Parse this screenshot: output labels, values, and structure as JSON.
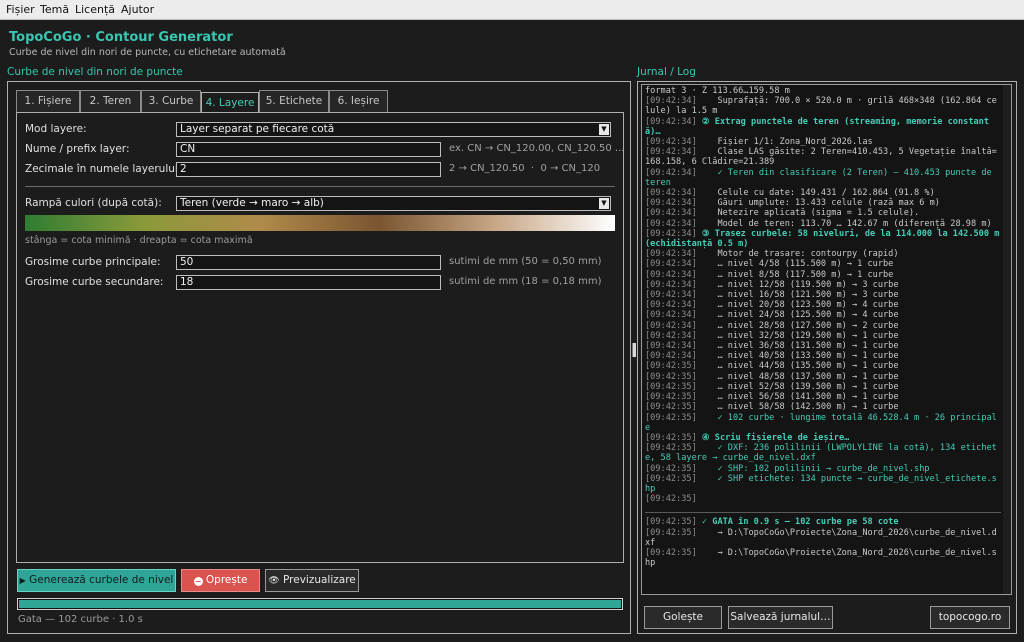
{
  "menu": {
    "items": [
      "Fișier",
      "Temă",
      "Licență",
      "Ajutor"
    ]
  },
  "header": {
    "title": "TopoCoGo · Contour Generator",
    "subtitle": "Curbe de nivel din nori de puncte, cu etichetare automată"
  },
  "left_panel": {
    "title": "Curbe de nivel din nori de puncte"
  },
  "tabs": [
    {
      "label": "1. Fișiere"
    },
    {
      "label": "2. Teren"
    },
    {
      "label": "3. Curbe"
    },
    {
      "label": "4. Layere"
    },
    {
      "label": "5. Etichete"
    },
    {
      "label": "6. Ieșire"
    }
  ],
  "active_tab": "4. Layere",
  "form": {
    "layer_mode": {
      "label": "Mod layere:",
      "value": "Layer separat pe fiecare cotă"
    },
    "layer_prefix": {
      "label": "Nume / prefix layer:",
      "value": "CN",
      "hint": "ex. CN → CN_120.00, CN_120.50 ..."
    },
    "layer_decimals": {
      "label": "Zecimale în numele layerului:",
      "value": "2",
      "hint": "2 → CN_120.50  ·  0 → CN_120"
    },
    "color_ramp": {
      "label": "Rampă culori (după cotă):",
      "value": "Teren (verde → maro → alb)",
      "caption": "stânga = cota minimă · dreapta = cota maximă",
      "colors": [
        "#2f7d32",
        "#8a9a3a",
        "#b08a4a",
        "#7a5530",
        "#c8a888",
        "#ffffff"
      ]
    },
    "major_thickness": {
      "label": "Grosime curbe principale:",
      "value": "50",
      "hint": "sutimi de mm (50 = 0,50 mm)"
    },
    "minor_thickness": {
      "label": "Grosime curbe secundare:",
      "value": "18",
      "hint": "sutimi de mm (18 = 0,18 mm)"
    }
  },
  "actions": {
    "generate": "Generează curbele de nivel",
    "stop": "Oprește",
    "preview": "Previzualizare"
  },
  "progress": {
    "value": 1.0
  },
  "status": "Gata — 102 curbe · 1.0 s",
  "log_panel": {
    "title": "Jurnal / Log"
  },
  "log": [
    {
      "ts": "",
      "text": "format 3 · Z 113.66…159.58 m",
      "style": ""
    },
    {
      "ts": "[09:42:34]",
      "text": "    Suprafață: 700.0 × 520.0 m · grilă 468×348 (162.864 celule) la 1.5 m",
      "style": ""
    },
    {
      "ts": "[09:42:34]",
      "text": " ② Extrag punctele de teren (streaming, memorie constantă)…",
      "style": "hl"
    },
    {
      "ts": "[09:42:34]",
      "text": "    Fișier 1/1: Zona_Nord_2026.las",
      "style": ""
    },
    {
      "ts": "[09:42:34]",
      "text": "    Clase LAS găsite: 2 Teren=410.453, 5 Vegetație înaltă=168.158, 6 Clădire=21.389",
      "style": ""
    },
    {
      "ts": "[09:42:34]",
      "text": "    ✓ Teren din clasificare (2 Teren) — 410.453 puncte de teren",
      "style": "ok"
    },
    {
      "ts": "[09:42:34]",
      "text": "    Celule cu date: 149.431 / 162.864 (91.8 %)",
      "style": ""
    },
    {
      "ts": "[09:42:34]",
      "text": "    Găuri umplute: 13.433 celule (rază max 6 m)",
      "style": ""
    },
    {
      "ts": "[09:42:34]",
      "text": "    Netezire aplicată (sigma = 1.5 celule).",
      "style": ""
    },
    {
      "ts": "[09:42:34]",
      "text": "    Model de teren: 113.70 … 142.67 m (diferență 28.98 m)",
      "style": ""
    },
    {
      "ts": "[09:42:34]",
      "text": " ③ Trasez curbele: 58 niveluri, de la 114.000 la 142.500 m (echidistanță 0.5 m)",
      "style": "hl"
    },
    {
      "ts": "[09:42:34]",
      "text": "    Motor de trasare: contourpy (rapid)",
      "style": ""
    },
    {
      "ts": "[09:42:34]",
      "text": "    … nivel 4/58 (115.500 m) → 1 curbe",
      "style": ""
    },
    {
      "ts": "[09:42:34]",
      "text": "    … nivel 8/58 (117.500 m) → 1 curbe",
      "style": ""
    },
    {
      "ts": "[09:42:34]",
      "text": "    … nivel 12/58 (119.500 m) → 3 curbe",
      "style": ""
    },
    {
      "ts": "[09:42:34]",
      "text": "    … nivel 16/58 (121.500 m) → 3 curbe",
      "style": ""
    },
    {
      "ts": "[09:42:34]",
      "text": "    … nivel 20/58 (123.500 m) → 4 curbe",
      "style": ""
    },
    {
      "ts": "[09:42:34]",
      "text": "    … nivel 24/58 (125.500 m) → 4 curbe",
      "style": ""
    },
    {
      "ts": "[09:42:34]",
      "text": "    … nivel 28/58 (127.500 m) → 2 curbe",
      "style": ""
    },
    {
      "ts": "[09:42:34]",
      "text": "    … nivel 32/58 (129.500 m) → 1 curbe",
      "style": ""
    },
    {
      "ts": "[09:42:34]",
      "text": "    … nivel 36/58 (131.500 m) → 1 curbe",
      "style": ""
    },
    {
      "ts": "[09:42:34]",
      "text": "    … nivel 40/58 (133.500 m) → 1 curbe",
      "style": ""
    },
    {
      "ts": "[09:42:35]",
      "text": "    … nivel 44/58 (135.500 m) → 1 curbe",
      "style": ""
    },
    {
      "ts": "[09:42:35]",
      "text": "    … nivel 48/58 (137.500 m) → 1 curbe",
      "style": ""
    },
    {
      "ts": "[09:42:35]",
      "text": "    … nivel 52/58 (139.500 m) → 1 curbe",
      "style": ""
    },
    {
      "ts": "[09:42:35]",
      "text": "    … nivel 56/58 (141.500 m) → 1 curbe",
      "style": ""
    },
    {
      "ts": "[09:42:35]",
      "text": "    … nivel 58/58 (142.500 m) → 1 curbe",
      "style": ""
    },
    {
      "ts": "[09:42:35]",
      "text": "    ✓ 102 curbe · lungime totală 46.528.4 m · 26 principale",
      "style": "ok"
    },
    {
      "ts": "[09:42:35]",
      "text": " ④ Scriu fișierele de ieșire…",
      "style": "hl"
    },
    {
      "ts": "[09:42:35]",
      "text": "    ✓ DXF: 236 polilinii (LWPOLYLINE la cotă), 134 etichete, 58 layere → curbe_de_nivel.dxf",
      "style": "ok"
    },
    {
      "ts": "[09:42:35]",
      "text": "    ✓ SHP: 102 polilinii → curbe_de_nivel.shp",
      "style": "ok"
    },
    {
      "ts": "[09:42:35]",
      "text": "    ✓ SHP etichete: 134 puncte → curbe_de_nivel_etichete.shp",
      "style": "ok"
    },
    {
      "ts": "[09:42:35]",
      "text": "",
      "style": ""
    }
  ],
  "log_summary": [
    {
      "ts": "[09:42:35]",
      "text": " ✓ GATA în 0.9 s — 102 curbe pe 58 cote",
      "style": "hl"
    },
    {
      "ts": "[09:42:35]",
      "text": "    → D:\\TopoCoGo\\Proiecte\\Zona_Nord_2026\\curbe_de_nivel.dxf",
      "style": ""
    },
    {
      "ts": "[09:42:35]",
      "text": "    → D:\\TopoCoGo\\Proiecte\\Zona_Nord_2026\\curbe_de_nivel.shp",
      "style": ""
    }
  ],
  "log_actions": {
    "clear": "Golește",
    "save": "Salvează jurnalul…",
    "site": "topocogo.ro"
  }
}
